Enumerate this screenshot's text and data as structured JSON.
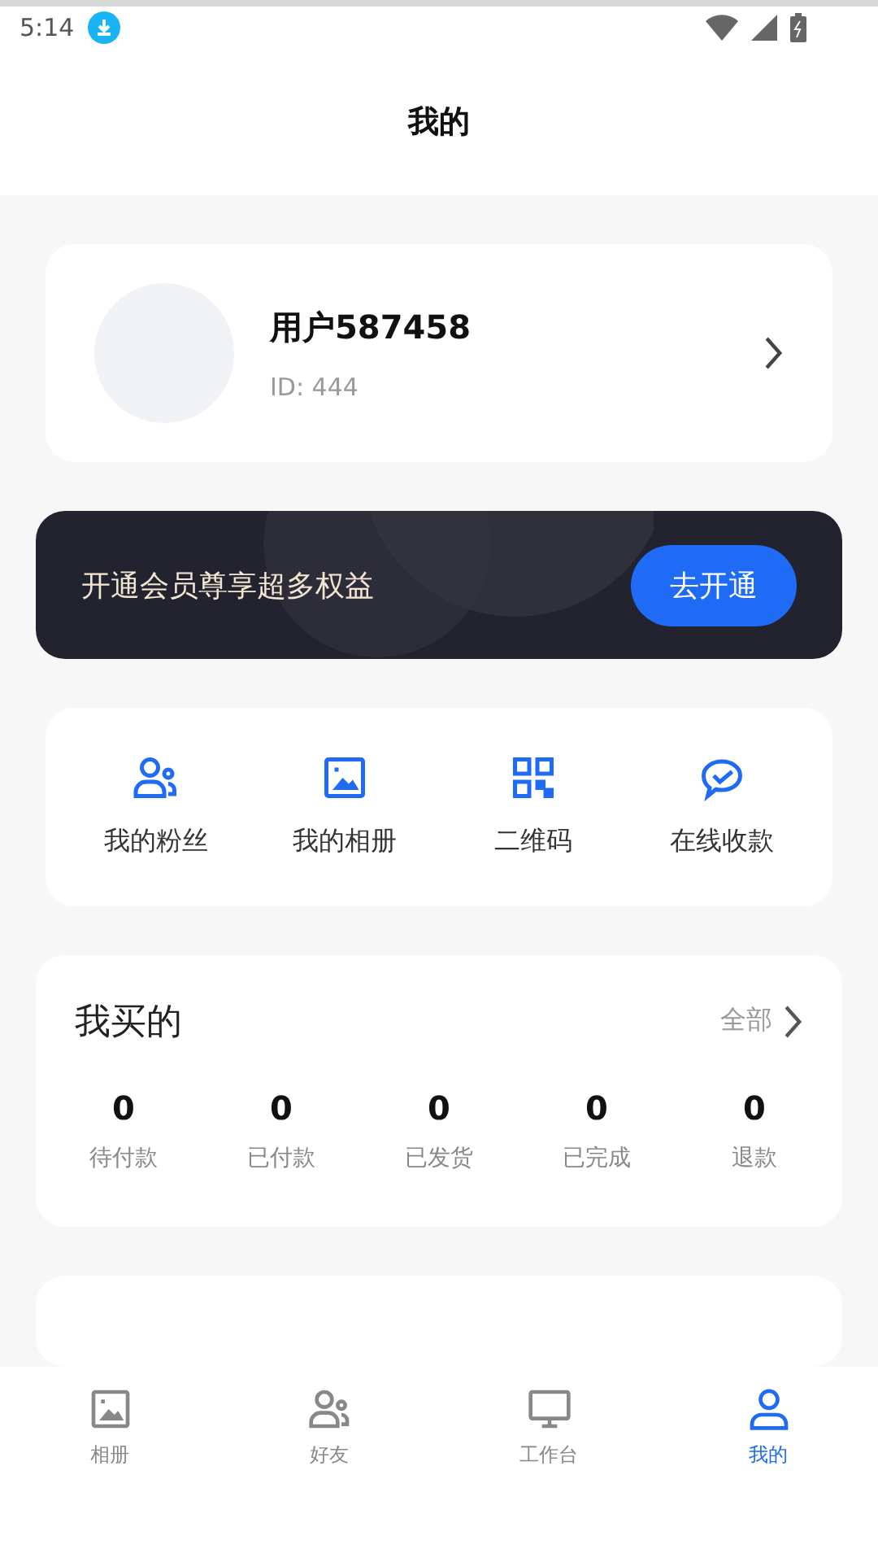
{
  "status_bar": {
    "time": "5:14"
  },
  "header": {
    "title": "我的"
  },
  "profile": {
    "name": "用户587458",
    "id": "ID: 444"
  },
  "vip_banner": {
    "text": "开通会员尊享超多权益",
    "button": "去开通"
  },
  "shortcuts": [
    {
      "kind": "fans",
      "label": "我的粉丝"
    },
    {
      "kind": "album",
      "label": "我的相册"
    },
    {
      "kind": "qrcode",
      "label": "二维码"
    },
    {
      "kind": "payment",
      "label": "在线收款"
    }
  ],
  "orders": {
    "title": "我买的",
    "more": "全部",
    "items": [
      {
        "count": "0",
        "label": "待付款"
      },
      {
        "count": "0",
        "label": "已付款"
      },
      {
        "count": "0",
        "label": "已发货"
      },
      {
        "count": "0",
        "label": "已完成"
      },
      {
        "count": "0",
        "label": "退款"
      }
    ]
  },
  "bottom_nav": [
    {
      "kind": "album",
      "label": "相册",
      "selected": false
    },
    {
      "kind": "friends",
      "label": "好友",
      "selected": false
    },
    {
      "kind": "desktop",
      "label": "工作台",
      "selected": false
    },
    {
      "kind": "profile",
      "label": "我的",
      "selected": true
    }
  ]
}
